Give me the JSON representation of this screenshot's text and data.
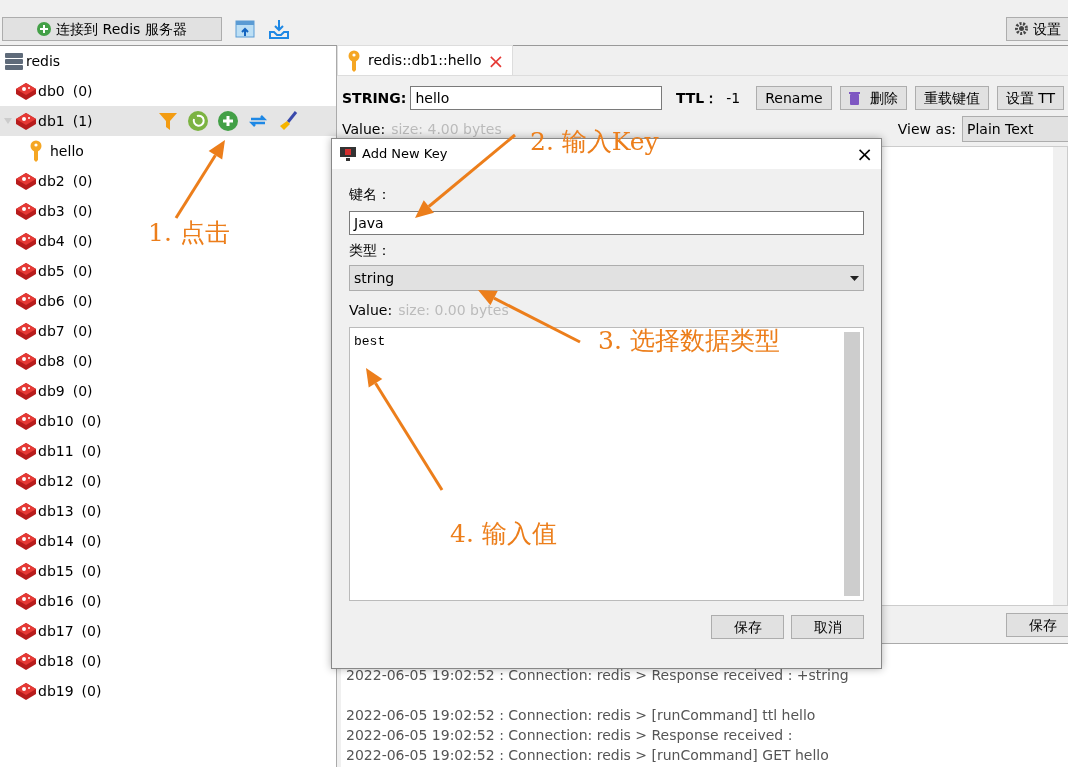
{
  "toolbar": {
    "connect_button": "连接到 Redis 服务器",
    "settings_button": "设置"
  },
  "tree": {
    "root": "redis",
    "databases": [
      {
        "name": "db0",
        "count": "(0)",
        "selected": false
      },
      {
        "name": "db1",
        "count": "(1)",
        "selected": true,
        "children": [
          {
            "name": "hello"
          }
        ]
      },
      {
        "name": "db2",
        "count": "(0)",
        "selected": false
      },
      {
        "name": "db3",
        "count": "(0)",
        "selected": false
      },
      {
        "name": "db4",
        "count": "(0)",
        "selected": false
      },
      {
        "name": "db5",
        "count": "(0)",
        "selected": false
      },
      {
        "name": "db6",
        "count": "(0)",
        "selected": false
      },
      {
        "name": "db7",
        "count": "(0)",
        "selected": false
      },
      {
        "name": "db8",
        "count": "(0)",
        "selected": false
      },
      {
        "name": "db9",
        "count": "(0)",
        "selected": false
      },
      {
        "name": "db10",
        "count": "(0)",
        "selected": false
      },
      {
        "name": "db11",
        "count": "(0)",
        "selected": false
      },
      {
        "name": "db12",
        "count": "(0)",
        "selected": false
      },
      {
        "name": "db13",
        "count": "(0)",
        "selected": false
      },
      {
        "name": "db14",
        "count": "(0)",
        "selected": false
      },
      {
        "name": "db15",
        "count": "(0)",
        "selected": false
      },
      {
        "name": "db16",
        "count": "(0)",
        "selected": false
      },
      {
        "name": "db17",
        "count": "(0)",
        "selected": false
      },
      {
        "name": "db18",
        "count": "(0)",
        "selected": false
      },
      {
        "name": "db19",
        "count": "(0)",
        "selected": false
      }
    ]
  },
  "tab": {
    "label": "redis::db1::hello",
    "close": "×"
  },
  "key_bar": {
    "type_label": "STRING:",
    "key": "hello",
    "ttl_label": "TTL：",
    "ttl": "-1",
    "buttons": [
      "Rename",
      "删除",
      "重载键值",
      "设置 TT"
    ]
  },
  "value_bar": {
    "label": "Value:",
    "size": "size: 4.00 bytes",
    "view_label": "View as:",
    "view": "Plain Text"
  },
  "save_button": "保存",
  "log": [
    [
      "2022-06-05 19:02:52 : Connection: redis > Response received : +string"
    ],
    [
      "2022-06-05 19:02:52 : Connection: redis > [runCommand] ttl hello",
      "2022-06-05 19:02:52 : Connection: redis > Response received :",
      "2022-06-05 19:02:52 : Connection: redis > [runCommand] GET hello"
    ]
  ],
  "dialog": {
    "title": "Add New Key",
    "close": "×",
    "key_label": "键名：",
    "key": "Java",
    "type_label": "类型：",
    "type": "string",
    "value_label": "Value:",
    "size": "size: 0.00 bytes",
    "value": "best",
    "buttons": [
      "保存",
      "取消"
    ]
  },
  "annotations": [
    "1. 点击",
    "2. 输入Key",
    "3. 选择数据类型",
    "4. 输入值"
  ]
}
